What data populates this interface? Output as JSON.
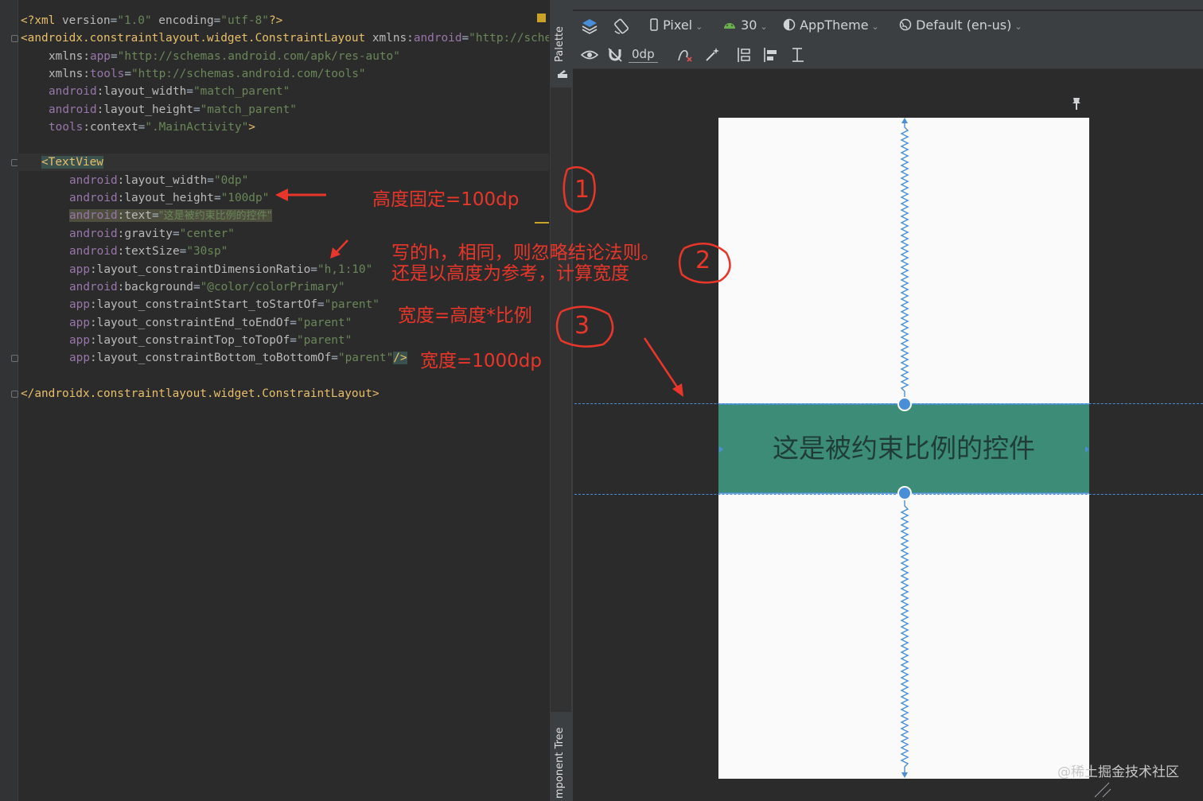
{
  "editor": {
    "lines": {
      "l1": {
        "a": "<?xml ",
        "b": "version",
        "c": "=",
        "d": "\"1.0\"",
        "e": " encoding",
        "f": "=",
        "g": "\"utf-8\"",
        "h": "?>"
      },
      "l2": {
        "a": "<androidx.constraintlayout.widget.ConstraintLayout ",
        "b": "xmlns:",
        "c": "android",
        "d": "=",
        "e": "\"http://sche"
      },
      "l3": {
        "a": "xmlns:",
        "b": "app",
        "c": "=",
        "d": "\"http://schemas.android.com/apk/res-auto\""
      },
      "l4": {
        "a": "xmlns:",
        "b": "tools",
        "c": "=",
        "d": "\"http://schemas.android.com/tools\""
      },
      "l5": {
        "a": "android",
        "b": ":layout_width",
        "c": "=",
        "d": "\"match_parent\""
      },
      "l6": {
        "a": "android",
        "b": ":layout_height",
        "c": "=",
        "d": "\"match_parent\""
      },
      "l7": {
        "a": "tools",
        "b": ":context",
        "c": "=",
        "d": "\".MainActivity\"",
        "e": ">"
      },
      "l8": {
        "a": "<TextView"
      },
      "l9": {
        "a": "android",
        "b": ":layout_width",
        "c": "=",
        "d": "\"0dp\""
      },
      "l10": {
        "a": "android",
        "b": ":layout_height",
        "c": "=",
        "d": "\"100dp\""
      },
      "l11": {
        "a": "android",
        "b": ":text",
        "c": "=",
        "d": "\"这是被约束比例的控件\""
      },
      "l12": {
        "a": "android",
        "b": ":gravity",
        "c": "=",
        "d": "\"center\""
      },
      "l13": {
        "a": "android",
        "b": ":textSize",
        "c": "=",
        "d": "\"30sp\""
      },
      "l14": {
        "a": "app",
        "b": ":layout_constraintDimensionRatio",
        "c": "=",
        "d": "\"h,1:10\""
      },
      "l15": {
        "a": "android",
        "b": ":background",
        "c": "=",
        "d": "\"@color/colorPrimary\""
      },
      "l16": {
        "a": "app",
        "b": ":layout_constraintStart_toStartOf",
        "c": "=",
        "d": "\"parent\""
      },
      "l17": {
        "a": "app",
        "b": ":layout_constraintEnd_toEndOf",
        "c": "=",
        "d": "\"parent\""
      },
      "l18": {
        "a": "app",
        "b": ":layout_constraintTop_toTopOf",
        "c": "=",
        "d": "\"parent\""
      },
      "l19": {
        "a": "app",
        "b": ":layout_constraintBottom_toBottomOf",
        "c": "=",
        "d": "\"parent\"",
        "e": "/>"
      },
      "l20": {
        "a": "</androidx.constraintlayout.widget.ConstraintLayout>"
      }
    }
  },
  "annotations": {
    "a1": "高度固定=100dp",
    "a2_line1": "写的h，相同，则忽略结论法则。",
    "a2_line2": "还是以高度为参考，计算宽度",
    "a3": "宽度=高度*比例",
    "a4": "宽度=1000dp",
    "marks": [
      "1",
      "2",
      "3"
    ]
  },
  "side_panels": {
    "palette": "Palette",
    "component_tree": "mponent Tree"
  },
  "toolbar": {
    "device": "Pixel",
    "api": "30",
    "theme": "AppTheme",
    "locale": "Default (en-us)",
    "margin": "0dp"
  },
  "preview": {
    "textview_text": "这是被约束比例的控件",
    "textview_color": "#3c8c78"
  },
  "watermark": "@稀土掘金技术社区",
  "colors": {
    "annotation_red": "#e8362b",
    "constraint_blue": "#4a8ed8"
  }
}
